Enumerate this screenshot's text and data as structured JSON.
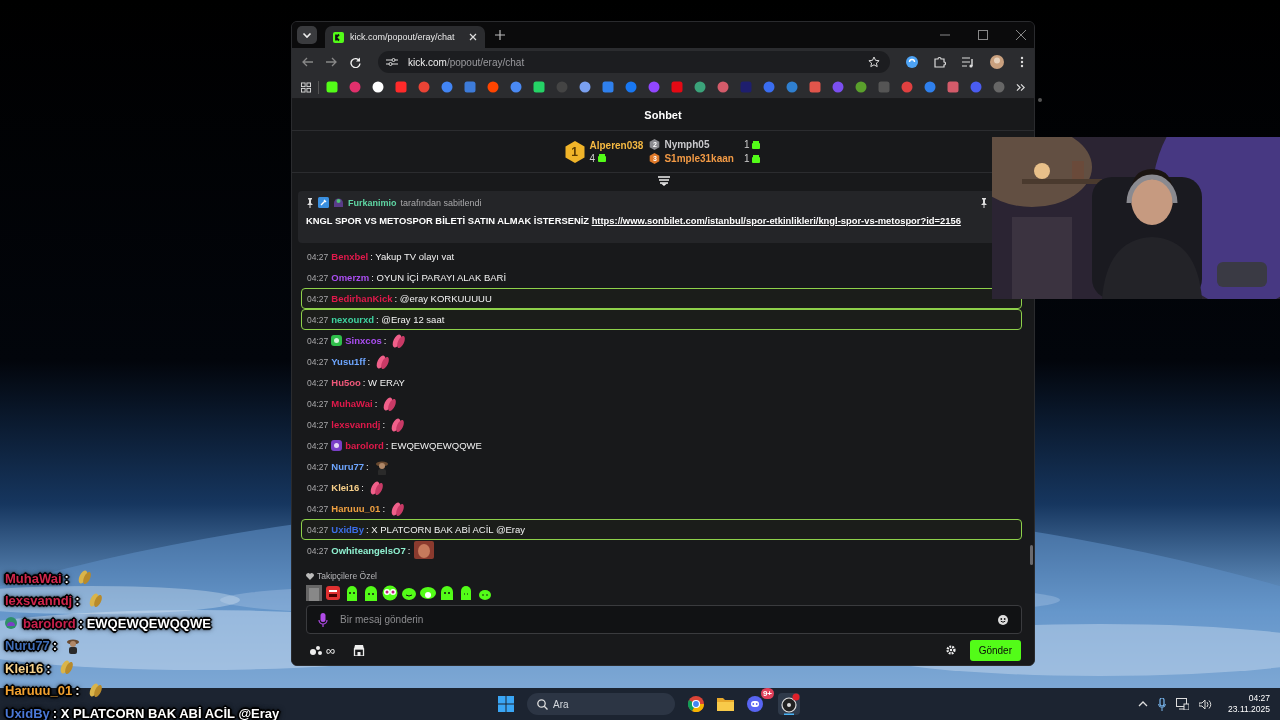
{
  "browser": {
    "tab_title": "kick.com/popout/eray/chat",
    "address": {
      "domain": "kick.com",
      "path": "/popout/eray/chat"
    }
  },
  "chat": {
    "title": "Sohbet",
    "leaderboard": [
      {
        "rank": "1",
        "name": "Alperen038",
        "count": "4",
        "color": "#f5b942"
      },
      {
        "rank": "2",
        "name": "Nymph05",
        "count": "1",
        "color": "#c9c9cc"
      },
      {
        "rank": "3",
        "name": "S1mple31kaan",
        "count": "1",
        "color": "#f29a45"
      }
    ],
    "pinned": {
      "by": "Furkanimio",
      "note": "tarafından sabitlendi",
      "text": "KNGL SPOR VS METOSPOR BİLETİ SATIN ALMAK İSTERSENİZ ",
      "link": "https://www.sonbilet.com/istanbul/spor-etkinlikleri/kngl-spor-vs-metospor?id=2156"
    },
    "messages": [
      {
        "time": "04:27",
        "user": "Benxbel",
        "color": "#e0194b",
        "text": ": Yakup TV olayı vat",
        "highlighted": false,
        "kind": "text"
      },
      {
        "time": "04:27",
        "user": "Omerzm",
        "color": "#a94ef0",
        "text": ": OYUN İÇİ PARAYI ALAK BARİ",
        "highlighted": false,
        "kind": "text"
      },
      {
        "time": "04:27",
        "user": "BedirhanKick",
        "color": "#e0194b",
        "text": ": @eray KORKUUUUU",
        "highlighted": true,
        "kind": "text"
      },
      {
        "time": "04:27",
        "user": "nexourxd",
        "color": "#3fd3a0",
        "text": ": @Eray 12 saat",
        "highlighted": true,
        "kind": "text"
      },
      {
        "time": "04:27",
        "user": "Sinxcos",
        "color": "#a94ef0",
        "text": ":",
        "highlighted": false,
        "badge": {
          "color": "#2fbf4a"
        },
        "kind": "pray"
      },
      {
        "time": "04:27",
        "user": "Yusu1ff",
        "color": "#6ea6ff",
        "text": ":",
        "highlighted": false,
        "kind": "pray"
      },
      {
        "time": "04:27",
        "user": "Hu5oo",
        "color": "#f0587a",
        "text": ": W ERAY",
        "highlighted": false,
        "kind": "text"
      },
      {
        "time": "04:27",
        "user": "MuhaWai",
        "color": "#e0194b",
        "text": ":",
        "highlighted": false,
        "kind": "pray"
      },
      {
        "time": "04:27",
        "user": "lexsvanndj",
        "color": "#e0194b",
        "text": ":",
        "highlighted": false,
        "kind": "pray"
      },
      {
        "time": "04:27",
        "user": "barolord",
        "color": "#e0194b",
        "text": ": EWQEWQEWQQWE",
        "highlighted": false,
        "badge": {
          "color": "#7a3fc8"
        },
        "kind": "text"
      },
      {
        "time": "04:27",
        "user": "Nuru77",
        "color": "#6ea6ff",
        "text": ":",
        "highlighted": false,
        "kind": "figure"
      },
      {
        "time": "04:27",
        "user": "Klei16",
        "color": "#f8d08a",
        "text": ":",
        "highlighted": false,
        "kind": "pray"
      },
      {
        "time": "04:27",
        "user": "Haruuu_01",
        "color": "#f0a040",
        "text": ":",
        "highlighted": false,
        "kind": "pray"
      },
      {
        "time": "04:27",
        "user": "UxidBy",
        "color": "#3c6ee8",
        "text": ": X PLATCORN BAK ABİ ACİL @Eray",
        "highlighted": true,
        "kind": "text"
      },
      {
        "time": "04:27",
        "user": "OwhiteangelsO7",
        "color": "#8ff0d0",
        "text": ":",
        "highlighted": false,
        "kind": "face"
      }
    ],
    "emote_section": "Takipçilere Özel",
    "input": {
      "placeholder": "Bir mesaj gönderin"
    },
    "footer": {
      "counter": "∞",
      "send": "Gönder"
    }
  },
  "overlay": [
    {
      "user": "MuhaWai",
      "color": "#d0264c",
      "text": " :",
      "kind": "pray"
    },
    {
      "user": "lexsvanndj",
      "color": "#d0264c",
      "text": " :",
      "kind": "pray"
    },
    {
      "user": "barolord",
      "color": "#c8204c",
      "text": " : EWQEWQEWQQWE",
      "badge": {
        "color": "#2f8f6a"
      },
      "kind": "text"
    },
    {
      "user": "Nuru77",
      "color": "#3f6db8",
      "text": " :",
      "kind": "figure"
    },
    {
      "user": "Klei16",
      "color": "#f5d08a",
      "text": " :",
      "kind": "pray"
    },
    {
      "user": "Haruuu_01",
      "color": "#f0a030",
      "text": " :",
      "kind": "pray"
    },
    {
      "user": "UxidBy",
      "color": "#4a78d6",
      "text": " : X PLATCORN BAK ABİ ACİL @Eray",
      "kind": "text"
    }
  ],
  "taskbar": {
    "search": {
      "placeholder": "Ara"
    },
    "notification_badge": "9+",
    "time": "04:27",
    "date": "23.11.2025"
  }
}
